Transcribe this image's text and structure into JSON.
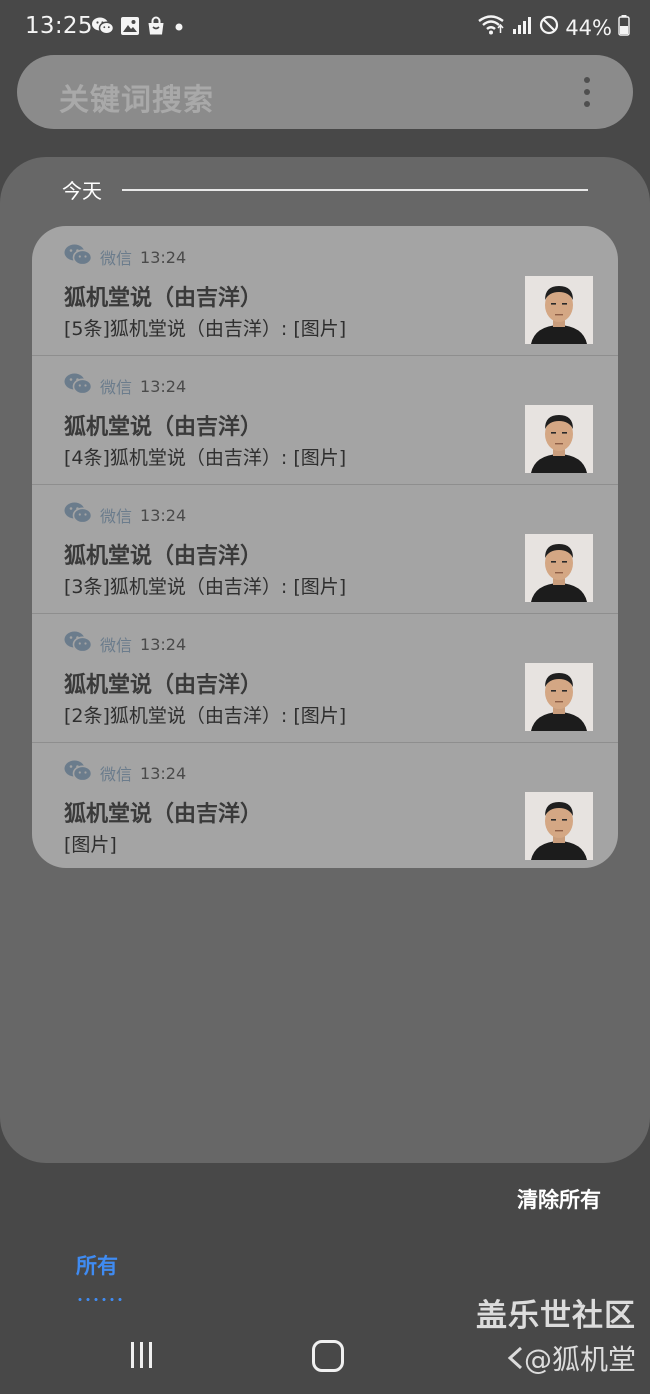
{
  "status_bar": {
    "time": "13:25",
    "battery": "44%",
    "left_icons": [
      "wechat-icon",
      "image-icon",
      "shopping-bag-icon",
      "dot-icon"
    ],
    "right_icons": [
      "wifi-icon",
      "signal-icon",
      "do-not-disturb-icon",
      "battery-icon"
    ]
  },
  "search": {
    "placeholder": "关键词搜索"
  },
  "section": {
    "label": "今天"
  },
  "notifications": [
    {
      "app": "微信",
      "time": "13:24",
      "title": "狐机堂说（由吉洋）",
      "text": "[5条]狐机堂说（由吉洋）: [图片]"
    },
    {
      "app": "微信",
      "time": "13:24",
      "title": "狐机堂说（由吉洋）",
      "text": "[4条]狐机堂说（由吉洋）: [图片]"
    },
    {
      "app": "微信",
      "time": "13:24",
      "title": "狐机堂说（由吉洋）",
      "text": "[3条]狐机堂说（由吉洋）: [图片]"
    },
    {
      "app": "微信",
      "time": "13:24",
      "title": "狐机堂说（由吉洋）",
      "text": "[2条]狐机堂说（由吉洋）: [图片]"
    },
    {
      "app": "微信",
      "time": "13:24",
      "title": "狐机堂说（由吉洋）",
      "text": "[图片]"
    }
  ],
  "actions": {
    "clear_all": "清除所有"
  },
  "tabs": {
    "all": "所有"
  },
  "watermark": {
    "line1": "盖乐世社区",
    "line2": "@狐机堂"
  },
  "colors": {
    "background": "#484848",
    "panel": "#676767",
    "card": "#a4a4a4",
    "accent": "#3f8bf2",
    "app_name": "#6b7c8c"
  }
}
